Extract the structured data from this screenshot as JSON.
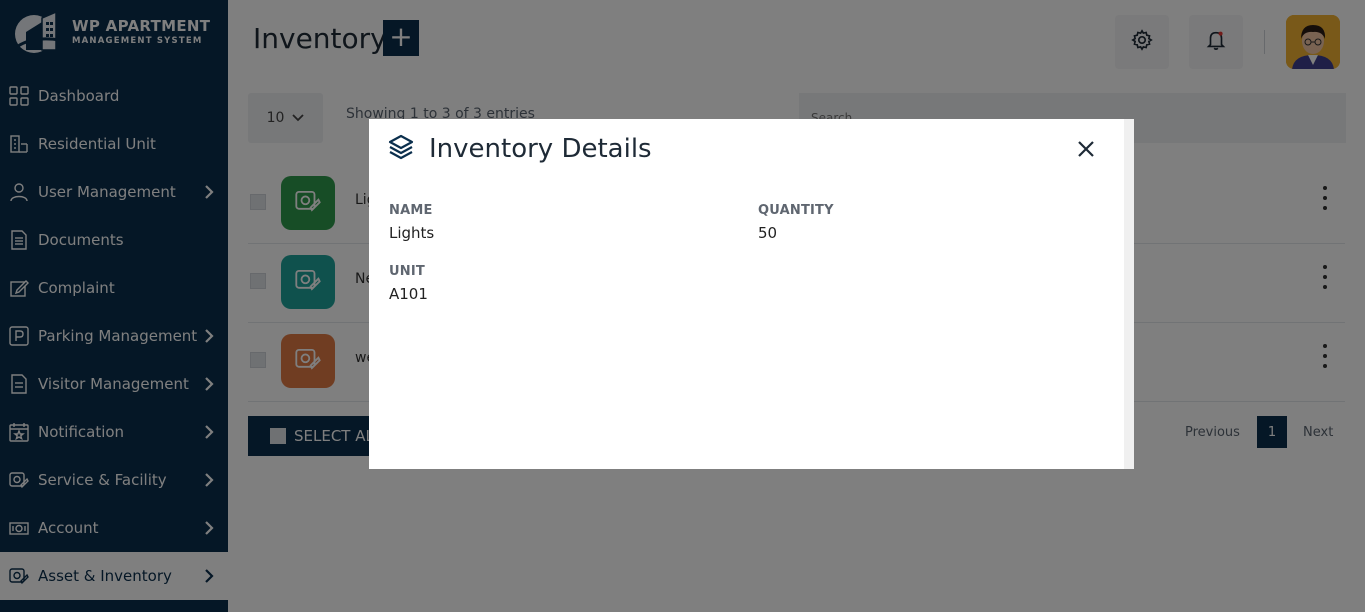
{
  "brand": {
    "title": "WP APARTMENT",
    "subtitle": "MANAGEMENT SYSTEM"
  },
  "sidebar": {
    "items": [
      {
        "label": "Dashboard",
        "icon": "grid-icon",
        "has_chevron": false
      },
      {
        "label": "Residential Unit",
        "icon": "building-icon",
        "has_chevron": false
      },
      {
        "label": "User Management",
        "icon": "user-icon",
        "has_chevron": true
      },
      {
        "label": "Documents",
        "icon": "document-icon",
        "has_chevron": false
      },
      {
        "label": "Complaint",
        "icon": "edit-icon",
        "has_chevron": false
      },
      {
        "label": "Parking Management",
        "icon": "parking-icon",
        "has_chevron": true
      },
      {
        "label": "Visitor Management",
        "icon": "clipboard-icon",
        "has_chevron": true
      },
      {
        "label": "Notification",
        "icon": "calendar-star-icon",
        "has_chevron": true
      },
      {
        "label": "Service & Facility",
        "icon": "service-icon",
        "has_chevron": true
      },
      {
        "label": "Account",
        "icon": "money-icon",
        "has_chevron": true
      },
      {
        "label": "Asset & Inventory",
        "icon": "asset-icon",
        "has_chevron": true,
        "active": true
      }
    ]
  },
  "header": {
    "title": "Inventory",
    "add_label": "+"
  },
  "table": {
    "length_value": "10",
    "showing_text": "Showing 1 to 3 of 3 entries",
    "search_placeholder": "Search...",
    "rows": [
      {
        "name": "Lig",
        "thumb_color": "#2f9a4c"
      },
      {
        "name": "Ne",
        "thumb_color": "#1fa39a"
      },
      {
        "name": "we",
        "thumb_color": "#e07a44"
      }
    ],
    "select_all_label": "SELECT AL",
    "pagination": {
      "previous": "Previous",
      "page": "1",
      "next": "Next"
    }
  },
  "modal": {
    "title": "Inventory Details",
    "fields": {
      "name_label": "NAME",
      "name_value": "Lights",
      "quantity_label": "QUANTITY",
      "quantity_value": "50",
      "unit_label": "UNIT",
      "unit_value": "A101"
    }
  },
  "colors": {
    "sidebar_bg": "#0b2f4d",
    "accent": "#0b2f4d",
    "overlay": "rgba(0,0,0,0.5)"
  }
}
